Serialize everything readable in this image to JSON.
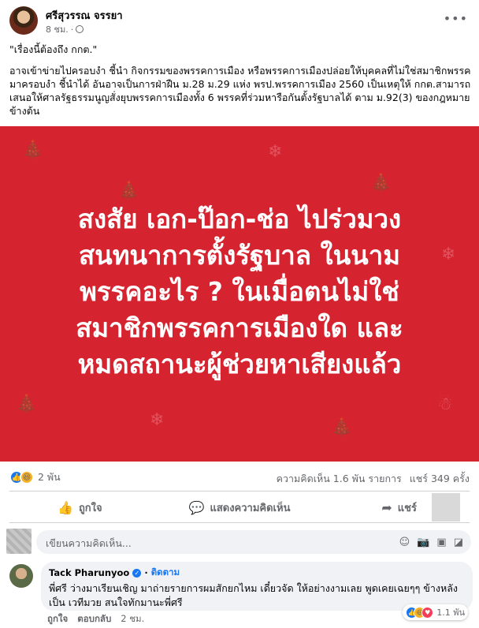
{
  "post": {
    "author": "ศรีสุวรรณ จรรยา",
    "time": "8 ชม.",
    "headline": "\"เรื่องนี้ต้องถึง กกต.\"",
    "body": "อาจเข้าข่ายไปครอบงำ ชี้นำ กิจกรรมของพรรคการเมือง หรือพรรคการเมืองปล่อยให้บุคคลที่ไม่ใช่สมาชิกพรรคมาครอบงำ ชี้นำได้ อันอาจเป็นการฝ่าฝืน ม.28 ม.29 แห่ง พรป.พรรคการเมือง 2560 เป็นเหตุให้ กกต.สามารถเสนอให้ศาลรัฐธรรมนูญสั่งยุบพรรคการเมืองทั้ง 6 พรรคที่ร่วมหารือกันตั้งรัฐบาลได้ ตาม ม.92(3) ของกฎหมายข้างต้น"
  },
  "image": {
    "background_color": "#d52430",
    "lines": [
      "สงสัย เอก-ป๊อก-ช่อ ไปร่วมวง",
      "สนทนาการตั้งรัฐบาล ในนาม",
      "พรรคอะไร ? ในเมื่อตนไม่ใช่",
      "สมาชิกพรรคการเมืองใด และ",
      "หมดสถานะผู้ช่วยหาเสียงแล้ว"
    ]
  },
  "stats": {
    "reactions_count": "2 พัน",
    "comments": "ความคิดเห็น 1.6 พัน รายการ",
    "shares": "แชร์ 349 ครั้ง"
  },
  "actions": {
    "like": "ถูกใจ",
    "comment": "แสดงความคิดเห็น",
    "share": "แชร์"
  },
  "comment_input": {
    "placeholder": "เขียนความคิดเห็น..."
  },
  "top_comment": {
    "name": "Tack Pharunyoo",
    "follow": "ติดตาม",
    "text": "พี่ศรี ว่างมาเรียนเชิญ มาถ่ายรายการผมสักยกไหม เดี๋ยวจัด ให้อย่างงามเลย พูดเคยเฉยๆๆ ข้างหลังเป็น เวทีมวย สนใจทักมานะพี่ศรี",
    "reaction_count": "1.1 พัน",
    "like": "ถูกใจ",
    "reply": "ตอบกลับ",
    "time": "2 ชม."
  }
}
